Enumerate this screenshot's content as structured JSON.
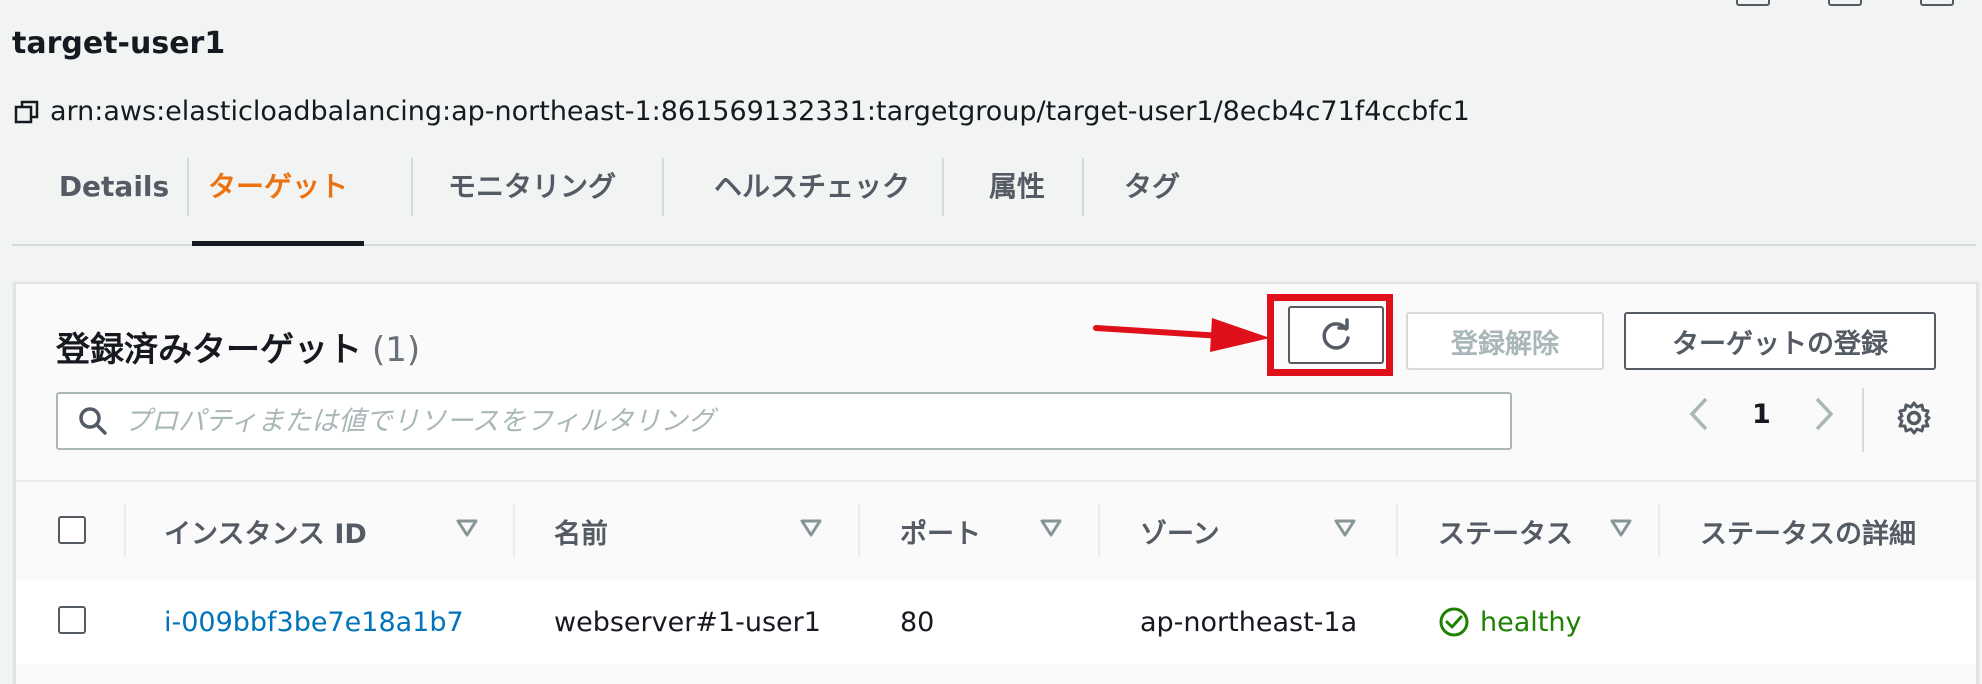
{
  "header": {
    "title": "target-user1",
    "arn": "arn:aws:elasticloadbalancing:ap-northeast-1:861569132331:targetgroup/target-user1/8ecb4c71f4ccbfc1"
  },
  "tabs": [
    {
      "label": "Details"
    },
    {
      "label": "ターゲット"
    },
    {
      "label": "モニタリング"
    },
    {
      "label": "ヘルスチェック"
    },
    {
      "label": "属性"
    },
    {
      "label": "タグ"
    }
  ],
  "active_tab": "ターゲット",
  "panel": {
    "title": "登録済みターゲット",
    "count": "(1)",
    "deregister_label": "登録解除",
    "register_label": "ターゲットの登録",
    "search_placeholder": "プロパティまたは値でリソースをフィルタリング",
    "page": "1"
  },
  "table": {
    "columns": [
      "インスタンス ID",
      "名前",
      "ポート",
      "ゾーン",
      "ステータス",
      "ステータスの詳細"
    ],
    "rows": [
      {
        "instance_id": "i-009bbf3be7e18a1b7",
        "name": "webserver#1-user1",
        "port": "80",
        "zone": "ap-northeast-1a",
        "status": "healthy",
        "status_detail": ""
      }
    ]
  },
  "icons": {
    "copy": "copy-icon",
    "refresh": "refresh-icon",
    "search": "search-icon",
    "prev": "chevron-left-icon",
    "next": "chevron-right-icon",
    "settings": "gear-icon",
    "sort": "sort-triangle-icon",
    "status": "check-circle-icon"
  },
  "colors": {
    "accent": "#ec7211",
    "link": "#0073bb",
    "healthy": "#1d8102",
    "annotation": "#e0101a"
  }
}
